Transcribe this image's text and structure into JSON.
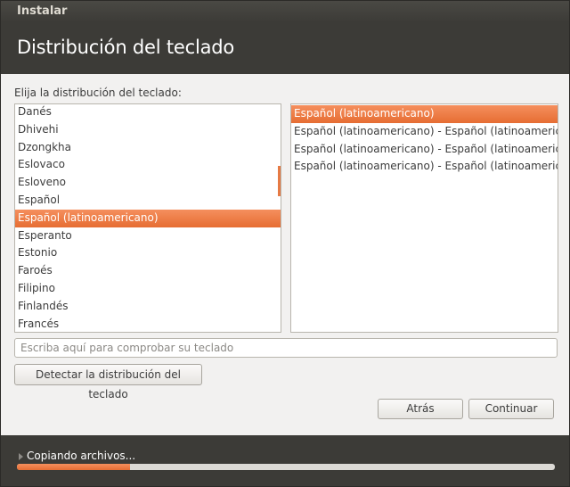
{
  "window": {
    "title": "Instalar"
  },
  "header": {
    "title": "Distribución del teclado"
  },
  "prompt": "Elija la distribución del teclado:",
  "layouts": {
    "selected_index": 6,
    "items": [
      "Danés",
      "Dhivehi",
      "Dzongkha",
      "Eslovaco",
      "Esloveno",
      "Español",
      "Español (latinoamericano)",
      "Esperanto",
      "Estonio",
      "Faroés",
      "Filipino",
      "Finlandés",
      "Francés"
    ]
  },
  "variants": {
    "selected_index": 0,
    "items": [
      "Español (latinoamericano)",
      "Español (latinoamericano) - Español (latinoamericano, eliminar teclas muertas)",
      "Español (latinoamericano) - Español (latinoamericano, incluir tilde muerta)",
      "Español (latinoamericano) - Español (latinoamericano, teclas muertas de Sun)"
    ]
  },
  "test_input": {
    "placeholder": "Escriba aquí para comprobar su teclado",
    "value": ""
  },
  "buttons": {
    "detect": "Detectar la distribución del teclado",
    "back": "Atrás",
    "continue": "Continuar"
  },
  "status": {
    "text": "Copiando archivos...",
    "progress": 0.21
  },
  "colors": {
    "accent": "#e66d33",
    "header_bg": "#3c3b37"
  }
}
